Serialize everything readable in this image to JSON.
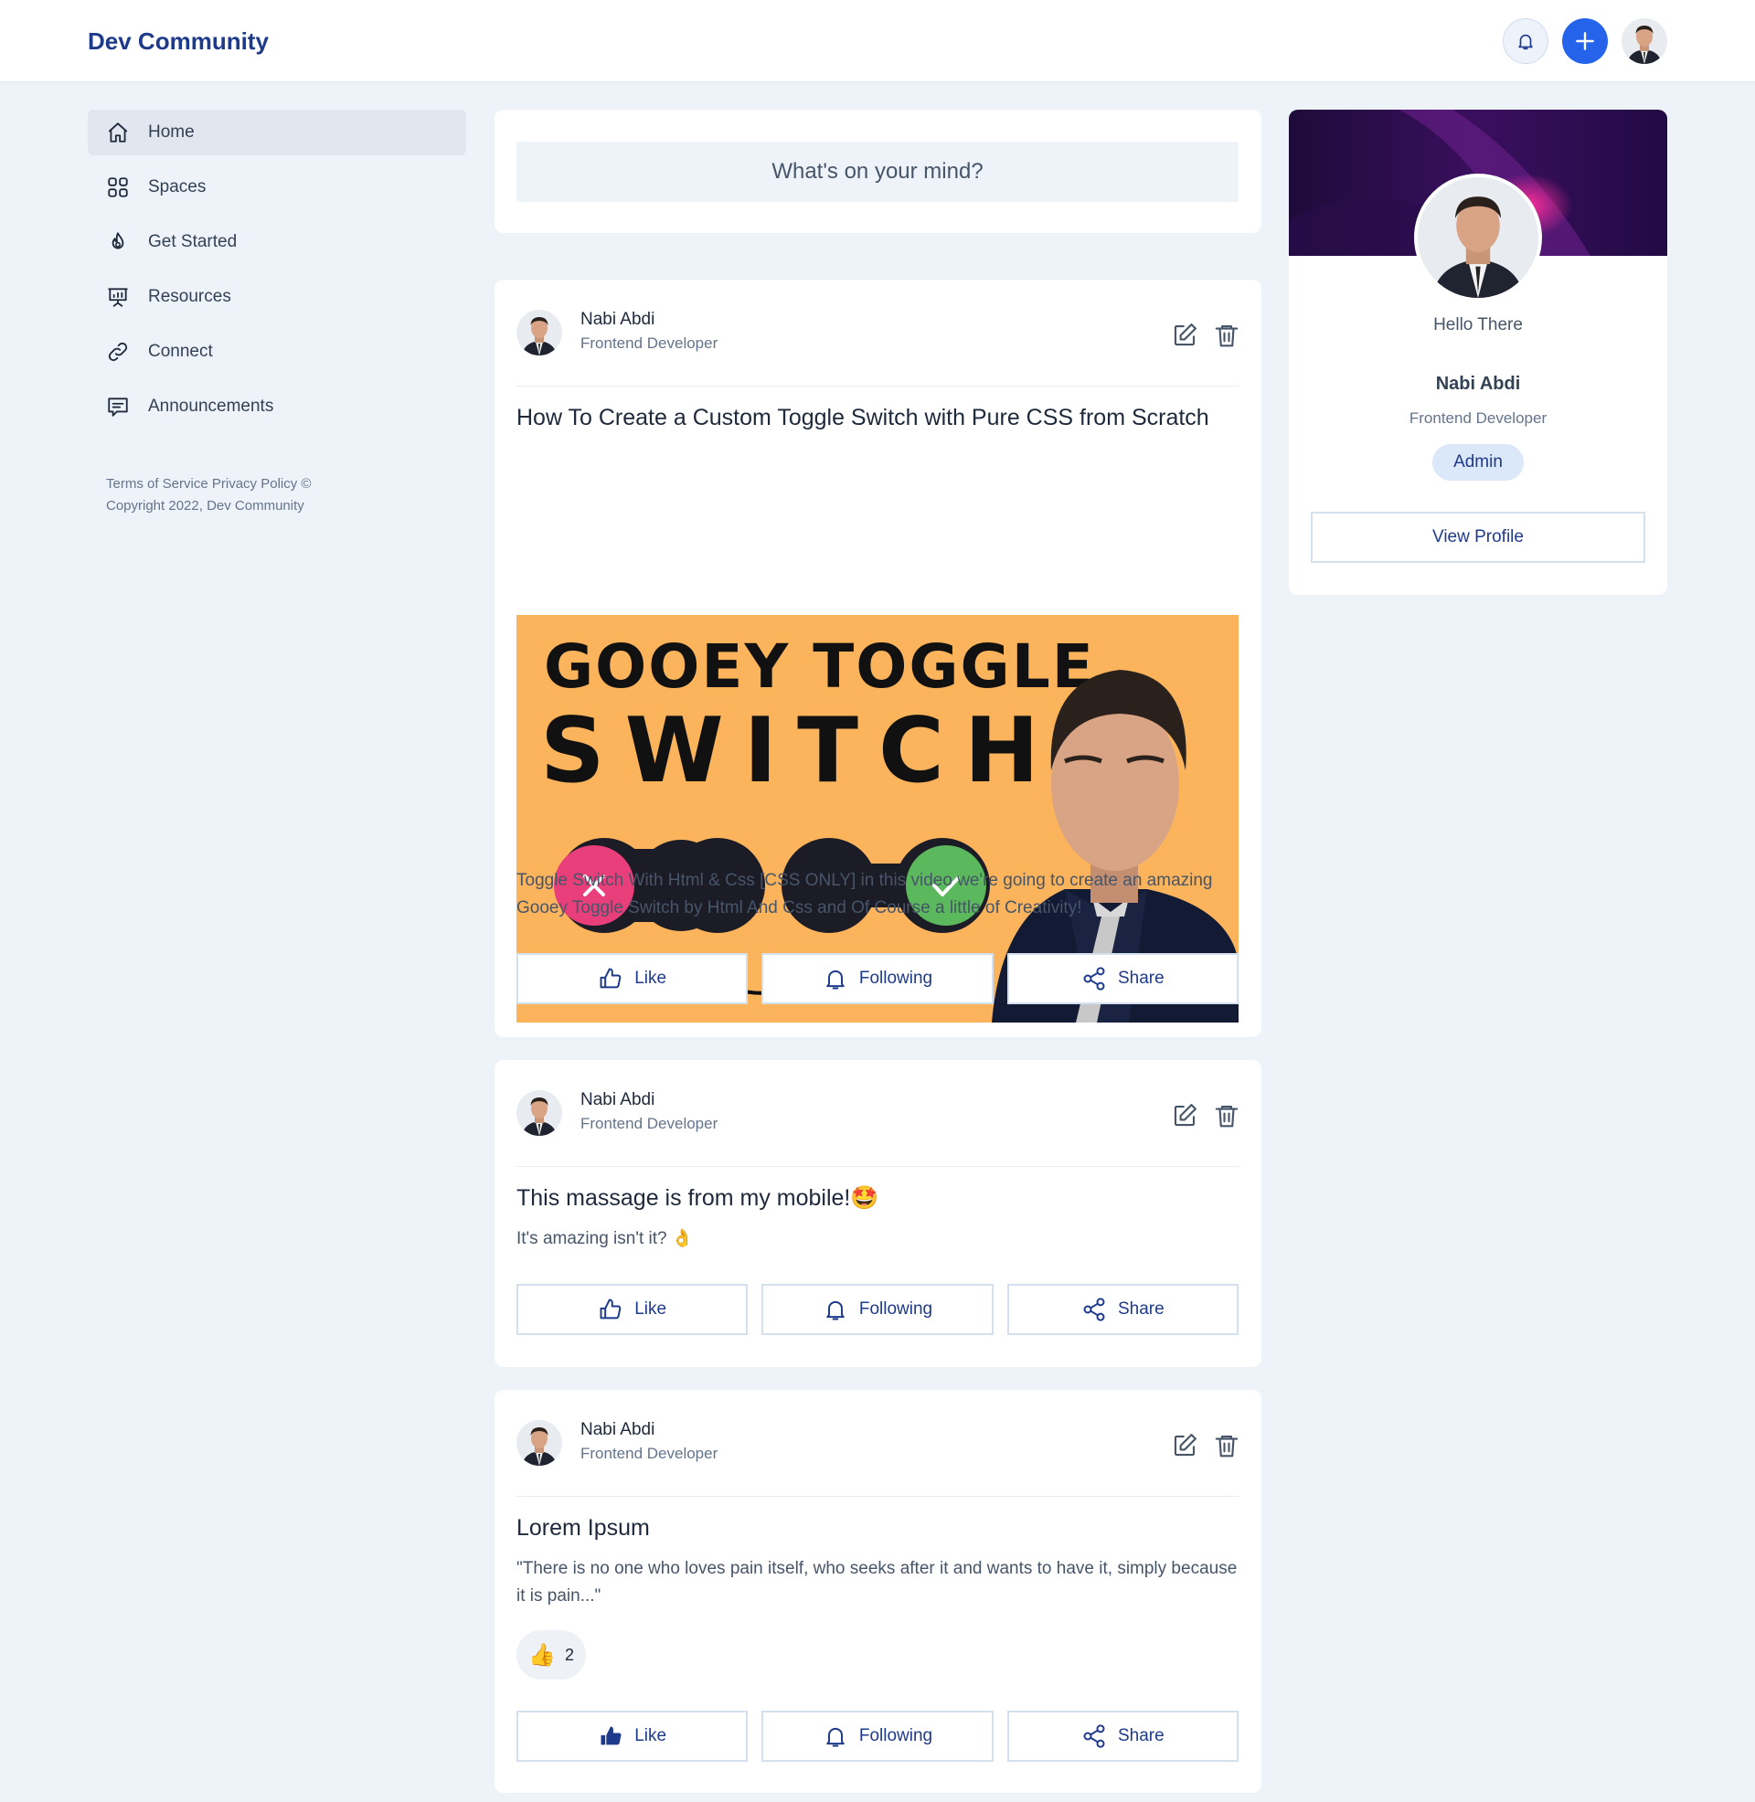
{
  "header": {
    "brand": "Dev Community",
    "notifications_icon": "bell-icon",
    "create_icon": "plus-icon",
    "accent_color": "#2563eb"
  },
  "sidebar": {
    "items": [
      {
        "label": "Home",
        "icon": "home-icon",
        "active": true
      },
      {
        "label": "Spaces",
        "icon": "grid-icon"
      },
      {
        "label": "Get Started",
        "icon": "flame-icon"
      },
      {
        "label": "Resources",
        "icon": "presentation-icon"
      },
      {
        "label": "Connect",
        "icon": "link-icon"
      },
      {
        "label": "Announcements",
        "icon": "message-icon"
      }
    ],
    "footer": {
      "terms": "Terms of Service",
      "privacy": "Privacy Policy ©",
      "copyright": "Copyright 2022, Dev Community"
    }
  },
  "composer": {
    "placeholder": "What's on your mind?"
  },
  "posts": [
    {
      "author": "Nabi Abdi",
      "role": "Frontend Developer",
      "title": "How To Create a Custom Toggle Switch with Pure CSS from Scratch",
      "thumbnail": {
        "line1": "GOOEY TOGGLE",
        "line2": "SWITCH"
      },
      "text": "Toggle Switch With Html & Css [CSS ONLY] in this video we're going to create an amazing Gooey Toggle Switch by Html And Css and Of Course a little of Creativity!",
      "actions": {
        "like": "Like",
        "following": "Following",
        "share": "Share"
      }
    },
    {
      "author": "Nabi Abdi",
      "role": "Frontend Developer",
      "title": "This massage is from my mobile!🤩",
      "text": "It's amazing isn't it? 👌",
      "actions": {
        "like": "Like",
        "following": "Following",
        "share": "Share"
      }
    },
    {
      "author": "Nabi Abdi",
      "role": "Frontend Developer",
      "title": "Lorem Ipsum",
      "text": "\"There is no one who loves pain itself, who seeks after it and wants to have it, simply because it is pain...\"",
      "reaction": {
        "emoji": "👍",
        "count": "2"
      },
      "actions": {
        "like": "Like",
        "following": "Following",
        "share": "Share"
      }
    }
  ],
  "profile": {
    "greeting": "Hello There",
    "name": "Nabi Abdi",
    "role": "Frontend Developer",
    "badge": "Admin",
    "view_profile": "View Profile"
  }
}
